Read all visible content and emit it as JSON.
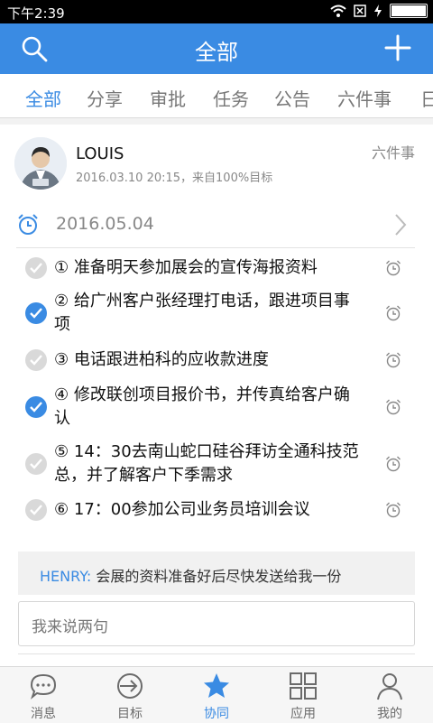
{
  "status_bar": {
    "time": "下午2:39"
  },
  "header": {
    "title": "全部"
  },
  "tabs": [
    "全部",
    "分享",
    "审批",
    "任务",
    "公告",
    "六件事",
    "日"
  ],
  "post": {
    "author": "LOUIS",
    "meta": "2016.03.10 20:15，来自100%目标",
    "type": "六件事",
    "date": "2016.05.04",
    "tasks": [
      {
        "number": "①",
        "text": "准备明天参加展会的宣传海报资料",
        "done": false
      },
      {
        "number": "②",
        "text": "给广州客户张经理打电话，跟进项目事项",
        "done": true
      },
      {
        "number": "③",
        "text": "电话跟进柏科的应收款进度",
        "done": false
      },
      {
        "number": "④",
        "text": "修改联创项目报价书，并传真给客户确认",
        "done": true
      },
      {
        "number": "⑤",
        "text": "14：30去南山蛇口硅谷拜访全通科技范总，并了解客户下季需求",
        "done": false
      },
      {
        "number": "⑥",
        "text": "17：00参加公司业务员培训会议",
        "done": false
      }
    ],
    "comment": {
      "name": "HENRY:",
      "text": "会展的资料准备好后尽快发送给我一份"
    },
    "input_placeholder": "我来说两句"
  },
  "bottom_nav": [
    {
      "label": "消息",
      "icon": "chat-icon"
    },
    {
      "label": "目标",
      "icon": "target-icon"
    },
    {
      "label": "协同",
      "icon": "star-icon",
      "active": true
    },
    {
      "label": "应用",
      "icon": "apps-icon"
    },
    {
      "label": "我的",
      "icon": "profile-icon"
    }
  ],
  "colors": {
    "accent": "#3a8be3",
    "header_bg": "#3a8be3"
  }
}
